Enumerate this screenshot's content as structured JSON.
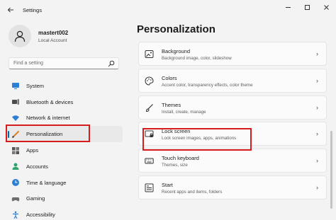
{
  "window": {
    "title": "Settings",
    "back_icon": "back-arrow-icon",
    "controls": [
      "minimize-icon",
      "maximize-icon",
      "close-icon"
    ]
  },
  "profile": {
    "name": "mastert002",
    "account_type": "Local Account"
  },
  "search": {
    "placeholder": "Find a setting"
  },
  "sidebar": {
    "items": [
      {
        "label": "System",
        "icon": "system-icon"
      },
      {
        "label": "Bluetooth & devices",
        "icon": "bluetooth-icon"
      },
      {
        "label": "Network & internet",
        "icon": "network-icon"
      },
      {
        "label": "Personalization",
        "icon": "personalization-icon",
        "active": true
      },
      {
        "label": "Apps",
        "icon": "apps-icon"
      },
      {
        "label": "Accounts",
        "icon": "accounts-icon"
      },
      {
        "label": "Time & language",
        "icon": "time-language-icon"
      },
      {
        "label": "Gaming",
        "icon": "gaming-icon"
      },
      {
        "label": "Accessibility",
        "icon": "accessibility-icon"
      }
    ]
  },
  "main": {
    "title": "Personalization",
    "cards": [
      {
        "title": "Background",
        "subtitle": "Background image, color, slideshow",
        "icon": "background-icon"
      },
      {
        "title": "Colors",
        "subtitle": "Accent color, transparency effects, color theme",
        "icon": "palette-icon"
      },
      {
        "title": "Themes",
        "subtitle": "Install, create, manage",
        "icon": "themes-brush-icon"
      },
      {
        "title": "Lock screen",
        "subtitle": "Lock screen images, apps, animations",
        "icon": "lock-screen-icon"
      },
      {
        "title": "Touch keyboard",
        "subtitle": "Themes, size",
        "icon": "keyboard-icon"
      },
      {
        "title": "Start",
        "subtitle": "Recent apps and items, folders",
        "icon": "start-icon"
      }
    ]
  },
  "colors": {
    "accent": "#0067c0",
    "highlight_box": "#d61c1c",
    "background": "#f3f3f3",
    "card": "#fbfbfb"
  }
}
